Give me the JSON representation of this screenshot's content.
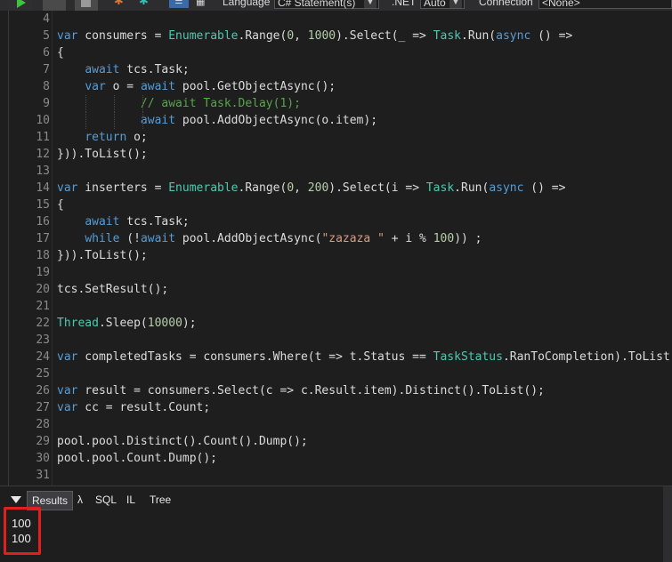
{
  "toolbar": {
    "language_label": "Language",
    "language_value": "C# Statement(s)",
    "net_label": ".NET",
    "net_value": "Auto",
    "connection_label": "Connection",
    "connection_value": "<None>"
  },
  "code_lines": [
    {
      "n": "4",
      "guides": []
    },
    {
      "n": "5",
      "guides": [],
      "tokens": [
        [
          "kw",
          "var"
        ],
        [
          "",
          " consumers = "
        ],
        [
          "ty",
          "Enumerable"
        ],
        [
          "",
          ".Range("
        ],
        [
          "nm",
          "0"
        ],
        [
          "",
          ", "
        ],
        [
          "nm",
          "1000"
        ],
        [
          "",
          ").Select(_ => "
        ],
        [
          "ty",
          "Task"
        ],
        [
          "",
          ".Run("
        ],
        [
          "kw",
          "async"
        ],
        [
          "",
          " () =>"
        ]
      ]
    },
    {
      "n": "6",
      "guides": [],
      "tokens": [
        [
          "",
          "{"
        ]
      ]
    },
    {
      "n": "7",
      "guides": [],
      "tokens": [
        [
          "",
          "    "
        ],
        [
          "kw",
          "await"
        ],
        [
          "",
          " tcs.Task;"
        ]
      ]
    },
    {
      "n": "8",
      "guides": [],
      "tokens": [
        [
          "",
          "    "
        ],
        [
          "kw",
          "var"
        ],
        [
          "",
          " o = "
        ],
        [
          "kw",
          "await"
        ],
        [
          "",
          " pool.GetObjectAsync();"
        ]
      ]
    },
    {
      "n": "9",
      "guides": [
        32,
        64,
        96
      ],
      "tokens": [
        [
          "",
          "            "
        ],
        [
          "cm",
          "// await Task.Delay(1);"
        ]
      ]
    },
    {
      "n": "10",
      "guides": [
        32,
        64,
        96
      ],
      "tokens": [
        [
          "",
          "            "
        ],
        [
          "kw",
          "await"
        ],
        [
          "",
          " pool.AddObjectAsync(o.item);"
        ]
      ]
    },
    {
      "n": "11",
      "guides": [],
      "tokens": [
        [
          "",
          "    "
        ],
        [
          "kw",
          "return"
        ],
        [
          "",
          " o;"
        ]
      ]
    },
    {
      "n": "12",
      "guides": [],
      "tokens": [
        [
          "",
          "})).ToList();"
        ]
      ]
    },
    {
      "n": "13",
      "guides": [],
      "tokens": []
    },
    {
      "n": "14",
      "guides": [],
      "tokens": [
        [
          "kw",
          "var"
        ],
        [
          "",
          " inserters = "
        ],
        [
          "ty",
          "Enumerable"
        ],
        [
          "",
          ".Range("
        ],
        [
          "nm",
          "0"
        ],
        [
          "",
          ", "
        ],
        [
          "nm",
          "200"
        ],
        [
          "",
          ").Select(i => "
        ],
        [
          "ty",
          "Task"
        ],
        [
          "",
          ".Run("
        ],
        [
          "kw",
          "async"
        ],
        [
          "",
          " () =>"
        ]
      ]
    },
    {
      "n": "15",
      "guides": [],
      "tokens": [
        [
          "",
          "{"
        ]
      ]
    },
    {
      "n": "16",
      "guides": [],
      "tokens": [
        [
          "",
          "    "
        ],
        [
          "kw",
          "await"
        ],
        [
          "",
          " tcs.Task;"
        ]
      ]
    },
    {
      "n": "17",
      "guides": [],
      "tokens": [
        [
          "",
          "    "
        ],
        [
          "kw",
          "while"
        ],
        [
          "",
          " (!"
        ],
        [
          "kw",
          "await"
        ],
        [
          "",
          " pool.AddObjectAsync("
        ],
        [
          "st",
          "\"zazaza \""
        ],
        [
          "",
          " + i % "
        ],
        [
          "nm",
          "100"
        ],
        [
          "",
          "))"
        ],
        [
          "",
          " ;"
        ]
      ]
    },
    {
      "n": "18",
      "guides": [],
      "tokens": [
        [
          "",
          "})).ToList();"
        ]
      ]
    },
    {
      "n": "19",
      "guides": [],
      "tokens": []
    },
    {
      "n": "20",
      "guides": [],
      "tokens": [
        [
          "",
          "tcs.SetResult();"
        ]
      ]
    },
    {
      "n": "21",
      "guides": [],
      "tokens": []
    },
    {
      "n": "22",
      "guides": [],
      "tokens": [
        [
          "ty",
          "Thread"
        ],
        [
          "",
          ".Sleep("
        ],
        [
          "nm",
          "10000"
        ],
        [
          "",
          ");"
        ]
      ]
    },
    {
      "n": "23",
      "guides": [],
      "tokens": []
    },
    {
      "n": "24",
      "guides": [],
      "tokens": [
        [
          "kw",
          "var"
        ],
        [
          "",
          " completedTasks = consumers.Where(t => t.Status == "
        ],
        [
          "ty",
          "TaskStatus"
        ],
        [
          "",
          ".RanToCompletion).ToList"
        ]
      ]
    },
    {
      "n": "25",
      "guides": [],
      "tokens": []
    },
    {
      "n": "26",
      "guides": [],
      "tokens": [
        [
          "kw",
          "var"
        ],
        [
          "",
          " result = consumers.Select(c => c.Result.item).Distinct().ToList();"
        ]
      ]
    },
    {
      "n": "27",
      "guides": [],
      "tokens": [
        [
          "kw",
          "var"
        ],
        [
          "",
          " cc = result.Count;"
        ]
      ]
    },
    {
      "n": "28",
      "guides": [],
      "tokens": []
    },
    {
      "n": "29",
      "guides": [],
      "tokens": [
        [
          "",
          "pool.pool.Distinct().Count().Dump();"
        ]
      ]
    },
    {
      "n": "30",
      "guides": [],
      "tokens": [
        [
          "",
          "pool.pool.Count.Dump();"
        ]
      ]
    },
    {
      "n": "31",
      "guides": [],
      "tokens": []
    }
  ],
  "results": {
    "tabs": [
      {
        "label": "Results",
        "active": true
      },
      {
        "label": "λ",
        "active": false
      },
      {
        "label": "SQL",
        "active": false
      },
      {
        "label": "IL",
        "active": false
      },
      {
        "label": "Tree",
        "active": false
      }
    ],
    "output": [
      "100",
      "100"
    ]
  },
  "colors": {
    "highlight_box": "#e01f1f",
    "run_icon": "#3cc43c"
  }
}
